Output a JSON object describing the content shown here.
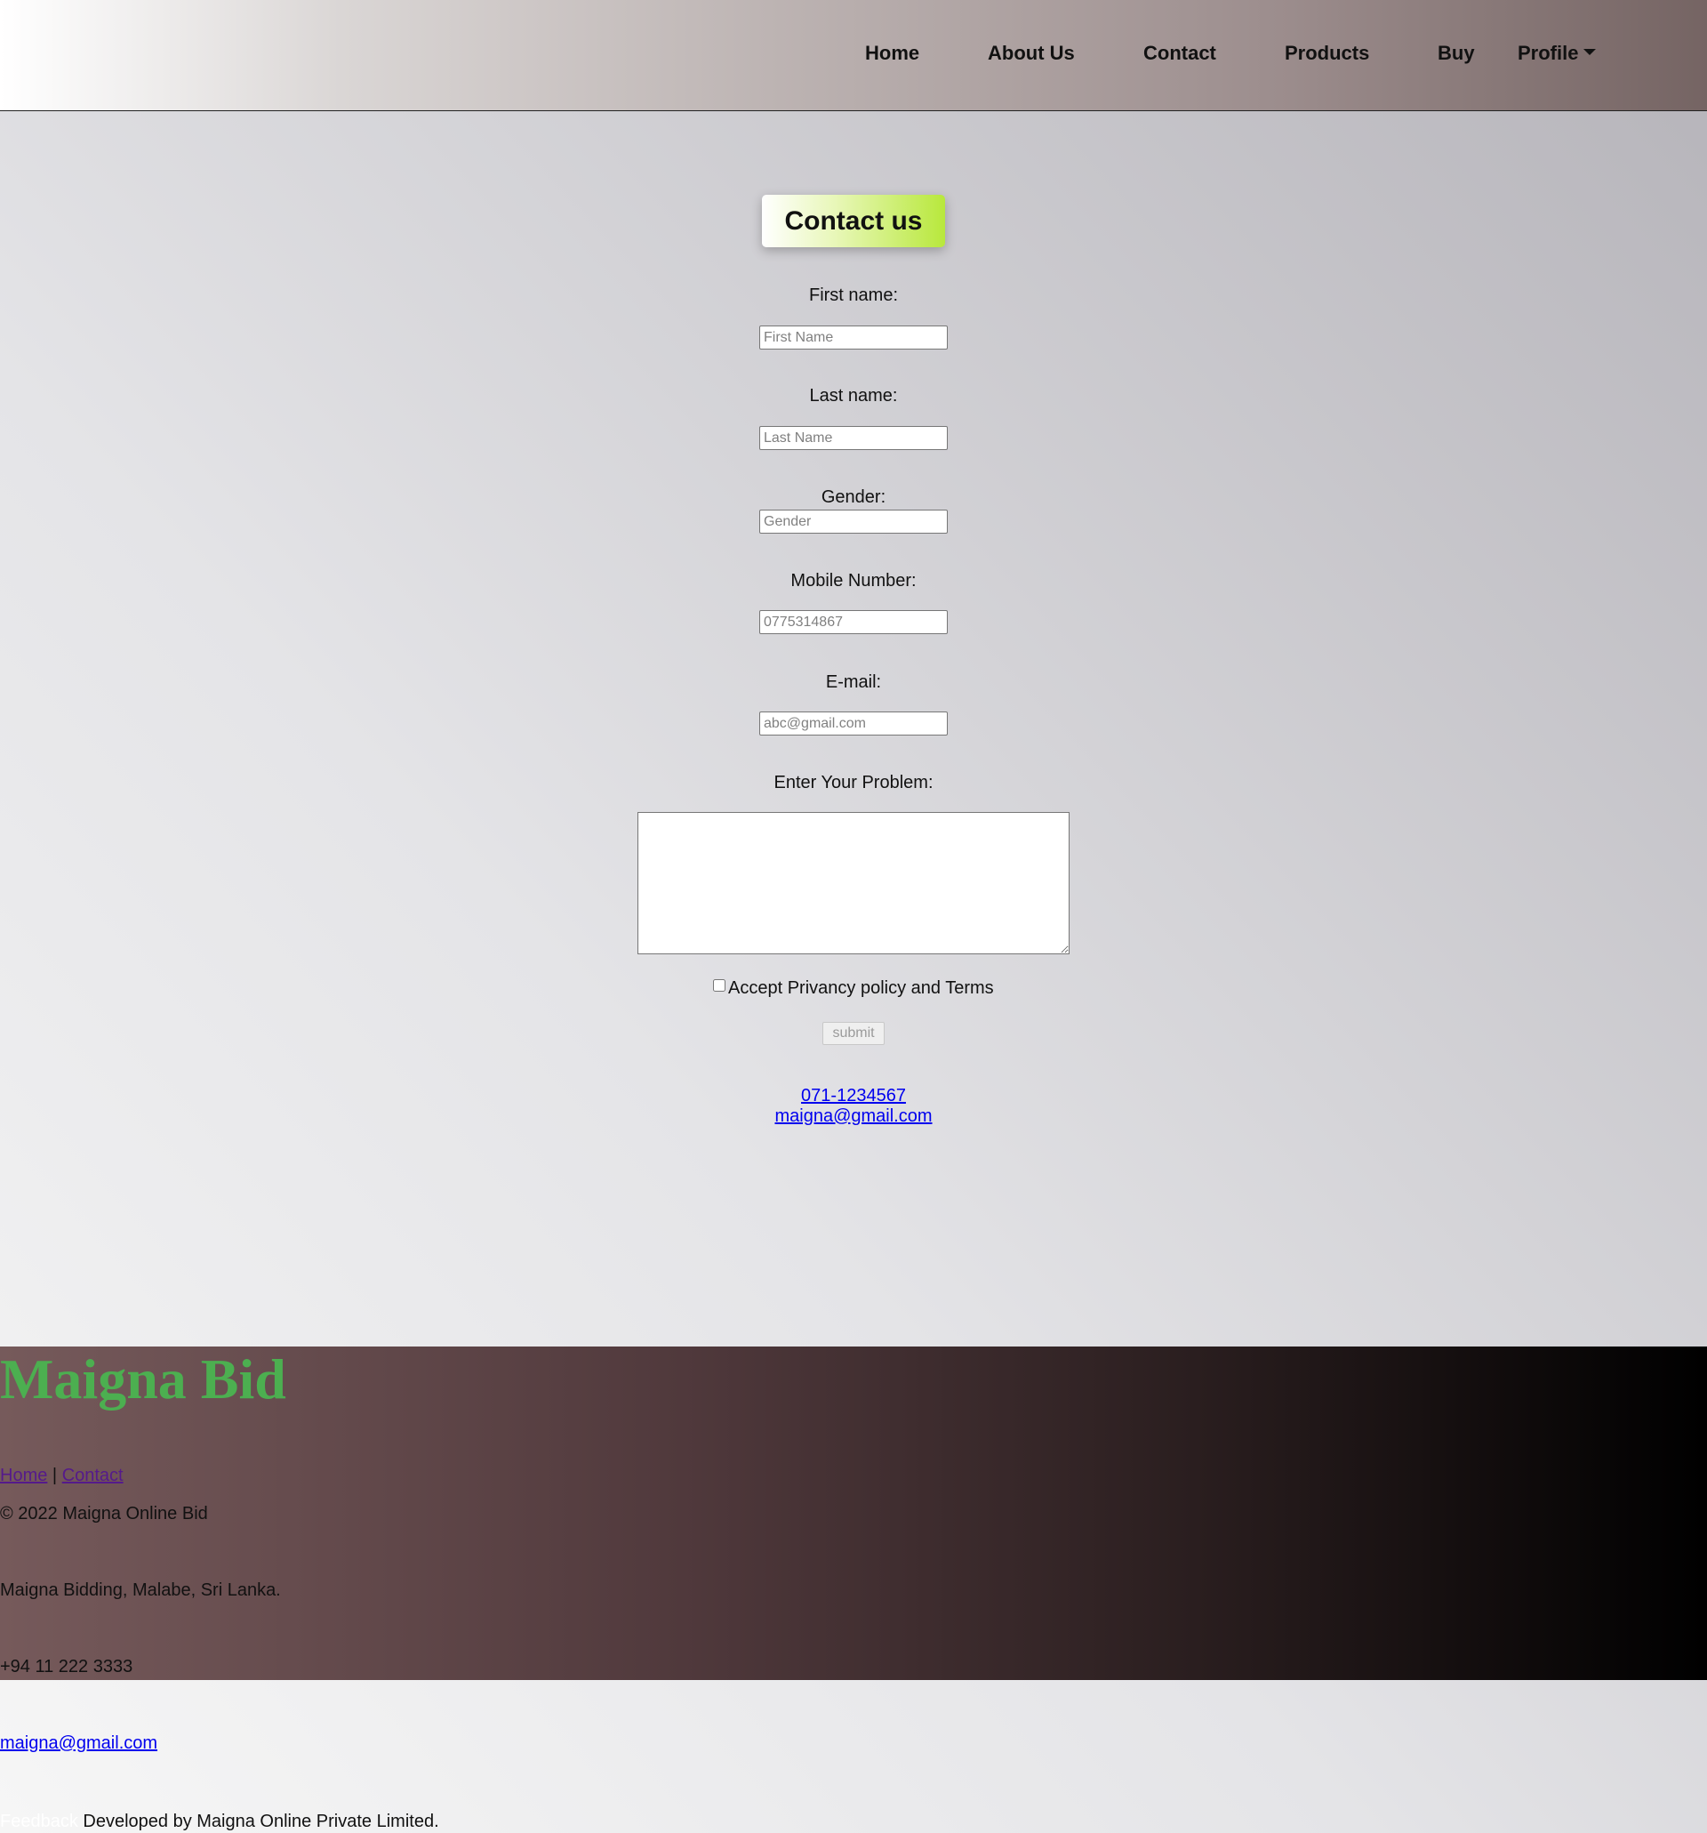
{
  "nav": {
    "home": "Home",
    "about": "About Us",
    "contact": "Contact",
    "products": "Products",
    "buy": "Buy",
    "profile": "Profile",
    "profile_icon": "caret-down-icon"
  },
  "form": {
    "title": "Contact us",
    "first_name_label": "First name:",
    "first_name_placeholder": "First Name",
    "last_name_label": "Last name:",
    "last_name_placeholder": "Last Name",
    "gender_label": "Gender:",
    "gender_placeholder": "Gender",
    "mobile_label": "Mobile Number:",
    "mobile_placeholder": "0775314867",
    "email_label": "E-mail:",
    "email_placeholder": "abc@gmail.com",
    "problem_label": "Enter Your Problem:",
    "accept_label": "Accept Privancy policy and Terms",
    "accept_checked": false,
    "submit_label": "submit"
  },
  "contact_info": {
    "phone": "071-1234567",
    "email": "maigna@gmail.com"
  },
  "footer": {
    "brand": "Maigna Bid",
    "link_home": "Home",
    "separator": "|",
    "link_contact": "Contact",
    "copyright": "© 2022 Maigna Online Bid",
    "address": "Maigna Bidding, Malabe, Sri Lanka.",
    "phone": "+94 11 222 3333",
    "email": "maigna@gmail.com",
    "feedback": "Feedback",
    "developed_by": "Developed by Maigna Online Private Limited."
  },
  "colors": {
    "brand_green": "#4caf50",
    "title_accent": "#b8e83c",
    "link_blue": "#0000ee",
    "visited_purple": "#551a8b"
  }
}
